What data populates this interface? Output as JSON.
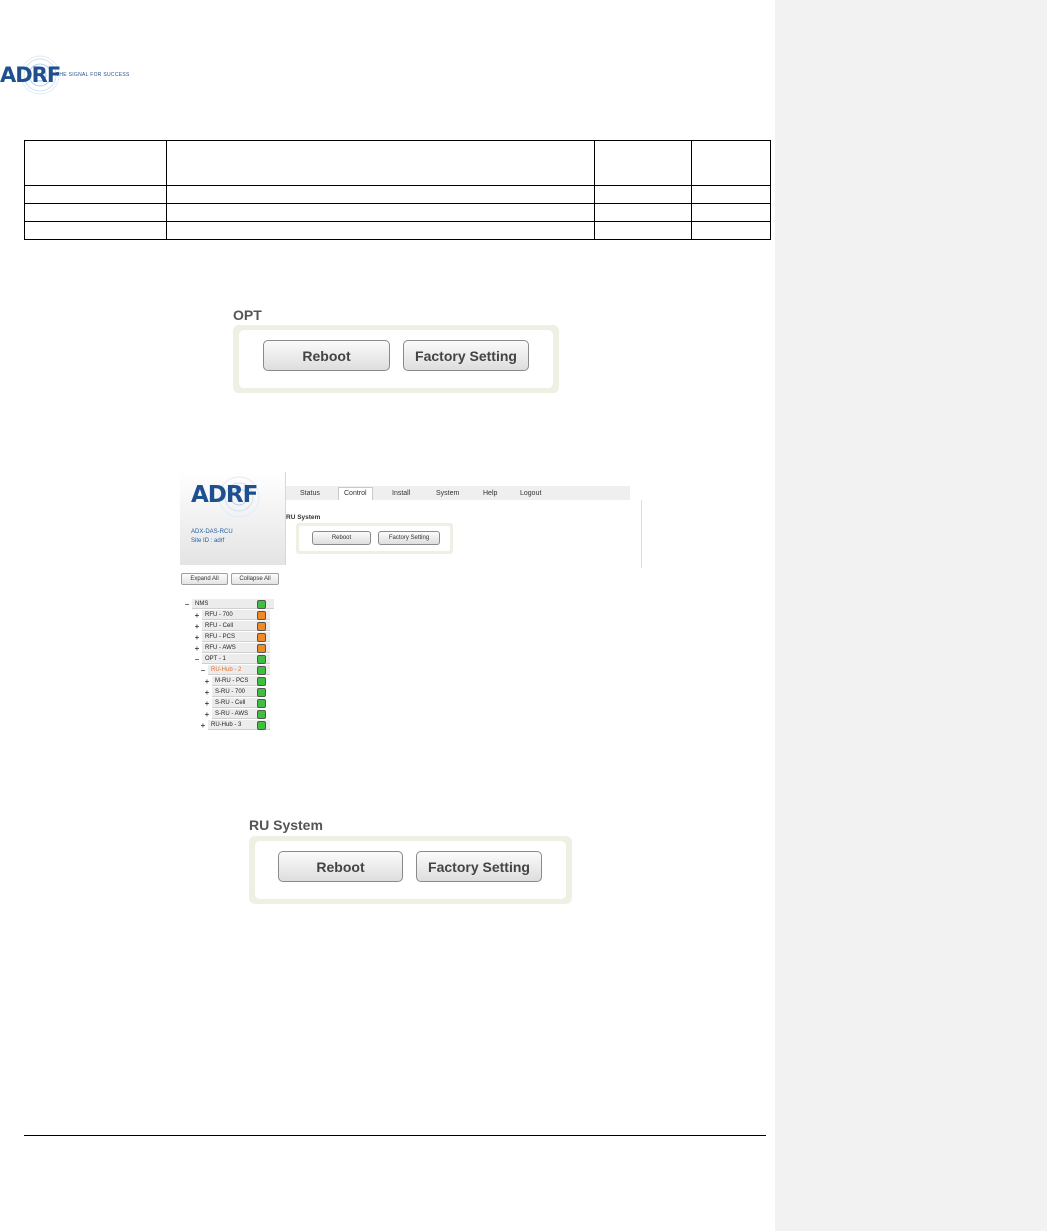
{
  "header": {
    "logo_text": "ADRF",
    "tagline": "THE SIGNAL FOR SUCCESS"
  },
  "revision_table": {
    "rows": [
      [
        "",
        "",
        "",
        ""
      ],
      [
        "",
        "",
        "",
        ""
      ],
      [
        "",
        "",
        "",
        ""
      ],
      [
        "",
        "",
        "",
        ""
      ]
    ]
  },
  "opt_panel": {
    "title": "OPT",
    "reboot_label": "Reboot",
    "factory_label": "Factory Setting"
  },
  "webui": {
    "logo_text": "ADRF",
    "system_name": "ADX-DAS-RCU",
    "site_id": "Site ID : adrf",
    "tabs": [
      "Status",
      "Control",
      "Install",
      "System",
      "Help",
      "Logout"
    ],
    "active_tab": "Control",
    "panel_title": "RU System",
    "reboot_label": "Reboot",
    "factory_label": "Factory Setting",
    "expand_all": "Expand All",
    "collapse_all": "Collapse All",
    "tree": [
      {
        "toggle": "−",
        "label": "NMS",
        "level": 0,
        "status": "#3fbf3f",
        "selected": false
      },
      {
        "toggle": "+",
        "label": "RFU - 700",
        "level": 1,
        "status": "#f08a24",
        "selected": false
      },
      {
        "toggle": "+",
        "label": "RFU - Cell",
        "level": 1,
        "status": "#f08a24",
        "selected": false
      },
      {
        "toggle": "+",
        "label": "RFU - PCS",
        "level": 1,
        "status": "#f08a24",
        "selected": false
      },
      {
        "toggle": "+",
        "label": "RFU - AWS",
        "level": 1,
        "status": "#f08a24",
        "selected": false
      },
      {
        "toggle": "−",
        "label": "OPT - 1",
        "level": 1,
        "status": "#3fbf3f",
        "selected": false
      },
      {
        "toggle": "−",
        "label": "RU-Hub - 2",
        "level": 2,
        "status": "#3fbf3f",
        "selected": true
      },
      {
        "toggle": "+",
        "label": "M-RU - PCS",
        "level": 3,
        "status": "#3fbf3f",
        "selected": false
      },
      {
        "toggle": "+",
        "label": "S-RU - 700",
        "level": 3,
        "status": "#3fbf3f",
        "selected": false
      },
      {
        "toggle": "+",
        "label": "S-RU - Cell",
        "level": 3,
        "status": "#3fbf3f",
        "selected": false
      },
      {
        "toggle": "+",
        "label": "S-RU - AWS",
        "level": 3,
        "status": "#3fbf3f",
        "selected": false
      },
      {
        "toggle": "+",
        "label": "RU-Hub - 3",
        "level": 2,
        "status": "#3fbf3f",
        "selected": false
      }
    ]
  },
  "ru_panel": {
    "title": "RU System",
    "reboot_label": "Reboot",
    "factory_label": "Factory Setting"
  },
  "colors": {
    "brand": "#1e4f8f",
    "status_ok": "#3fbf3f",
    "status_warn": "#f08a24",
    "comment_pane": "#f2f2f2"
  }
}
